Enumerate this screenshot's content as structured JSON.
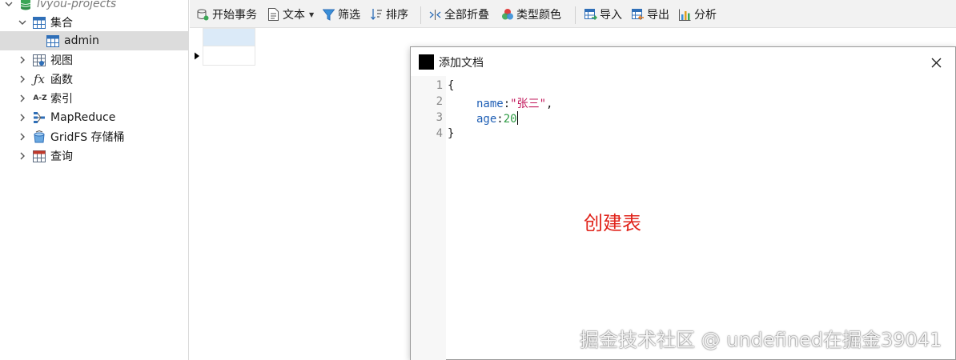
{
  "tree": {
    "db": {
      "label": "lvyou-projects",
      "icon": "database-icon"
    },
    "collections": {
      "label": "集合",
      "icon": "table-icon"
    },
    "admin": {
      "label": "admin",
      "icon": "table-icon"
    },
    "views": {
      "label": "视图",
      "icon": "view-icon"
    },
    "functions": {
      "label": "函数",
      "icon": "function-icon"
    },
    "indexes": {
      "label": "索引",
      "icon": "sort-az-icon"
    },
    "mapreduce": {
      "label": "MapReduce",
      "icon": "mapreduce-icon"
    },
    "gridfs": {
      "label": "GridFS 存储桶",
      "icon": "gridfs-icon"
    },
    "queries": {
      "label": "查询",
      "icon": "query-icon"
    }
  },
  "toolbar": {
    "begin_transaction": "开始事务",
    "text": "文本",
    "filter": "筛选",
    "sort": "排序",
    "collapse_all": "全部折叠",
    "type_color": "类型颜色",
    "import": "导入",
    "export": "导出",
    "analyze": "分析"
  },
  "dialog": {
    "title": "添加文档",
    "lines": [
      "1",
      "2",
      "3",
      "4"
    ],
    "code": {
      "open": "{",
      "key1": "name",
      "colon": ":",
      "val1": "\"张三\"",
      "comma": ",",
      "key2": "age",
      "val2": "20",
      "close": "}"
    },
    "annotation": "创建表"
  },
  "watermark": "掘金技术社区 @ undefined在掘金39041",
  "colors": {
    "selection_row": "#dcdcdc",
    "grid_selected_cell": "#dbeaf8",
    "annotation_red": "#e0241b",
    "json_key_blue": "#1f5fb5",
    "json_string_pink": "#c2185b",
    "json_number_green": "#2e9b44"
  }
}
